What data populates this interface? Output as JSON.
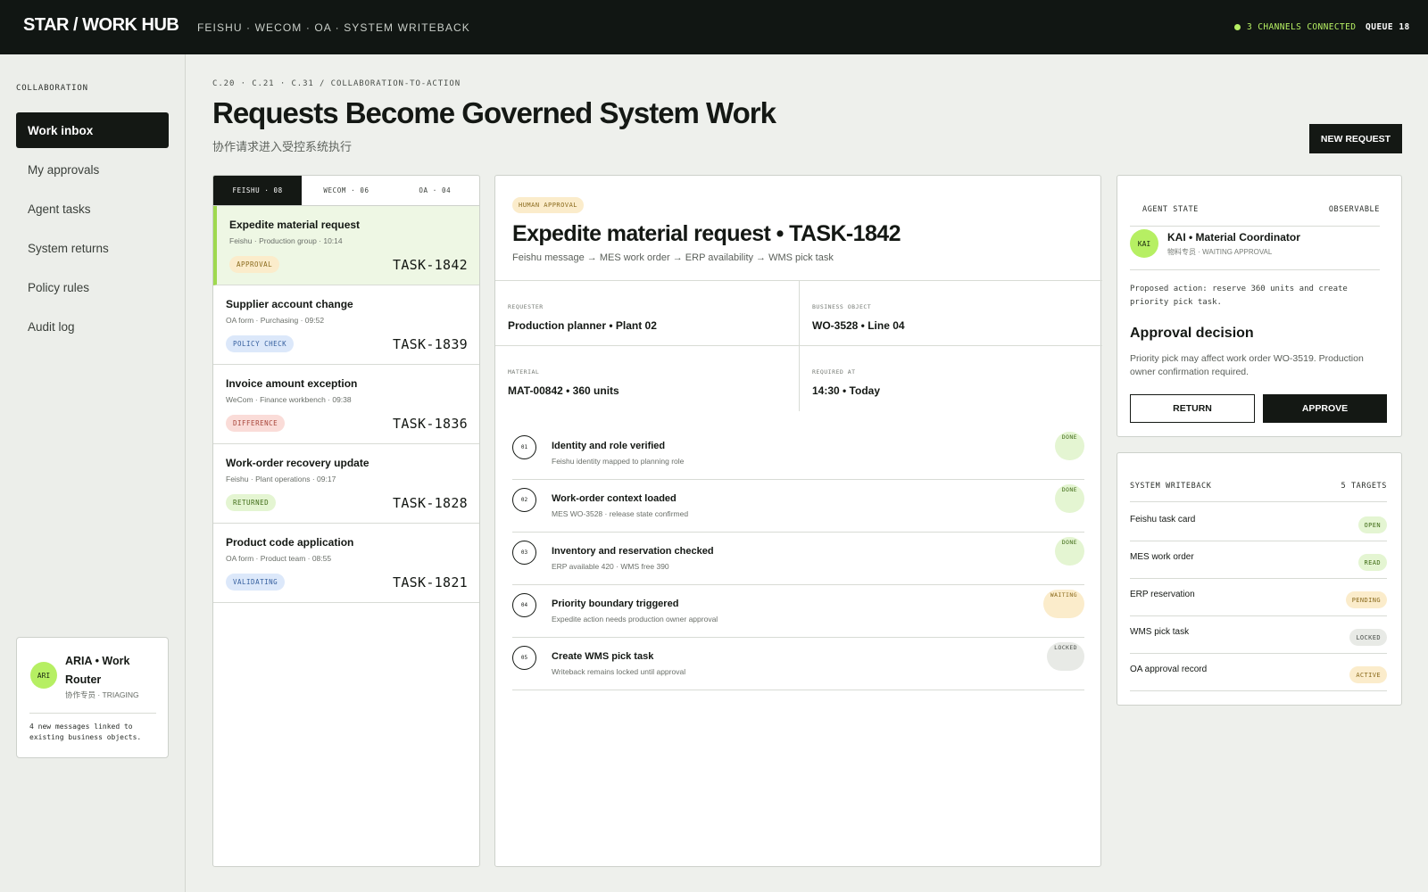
{
  "header": {
    "brand": "STAR / WORK HUB",
    "nav": "FEISHU · WECOM · OA · SYSTEM WRITEBACK",
    "channels": "3 CHANNELS CONNECTED",
    "queue": "QUEUE 18"
  },
  "sidebar": {
    "section_label": "COLLABORATION",
    "items": [
      {
        "label": "Work inbox"
      },
      {
        "label": "My approvals"
      },
      {
        "label": "Agent tasks"
      },
      {
        "label": "System returns"
      },
      {
        "label": "Policy rules"
      },
      {
        "label": "Audit log"
      }
    ],
    "agent": {
      "initials": "ARI",
      "name": "ARIA • Work Router",
      "sub": "协作专员 · TRIAGING",
      "message": "4 new messages linked to existing business objects."
    }
  },
  "page": {
    "breadcrumb": "C.20 · C.21 · C.31 / COLLABORATION-TO-ACTION",
    "title": "Requests Become Governed System Work",
    "subtitle": "协作请求进入受控系统执行",
    "new_request": "NEW REQUEST"
  },
  "list": {
    "tabs": [
      {
        "label": "FEISHU · 08"
      },
      {
        "label": "WECOM · 06"
      },
      {
        "label": "OA · 04"
      }
    ],
    "requests": [
      {
        "title": "Expedite material request",
        "meta": "Feishu · Production group · 10:14",
        "badge": "APPROVAL",
        "id": "TASK-1842"
      },
      {
        "title": "Supplier account change",
        "meta": "OA form · Purchasing · 09:52",
        "badge": "POLICY CHECK",
        "id": "TASK-1839"
      },
      {
        "title": "Invoice amount exception",
        "meta": "WeCom · Finance workbench · 09:38",
        "badge": "DIFFERENCE",
        "id": "TASK-1836"
      },
      {
        "title": "Work-order recovery update",
        "meta": "Feishu · Plant operations · 09:17",
        "badge": "RETURNED",
        "id": "TASK-1828"
      },
      {
        "title": "Product code application",
        "meta": "OA form · Product team · 08:55",
        "badge": "VALIDATING",
        "id": "TASK-1821"
      }
    ]
  },
  "detail": {
    "badge": "HUMAN APPROVAL",
    "title": "Expedite material request • TASK-1842",
    "flow": "Feishu message → MES work order → ERP availability → WMS pick task",
    "fields": [
      {
        "label": "REQUESTER",
        "value": "Production planner • Plant 02"
      },
      {
        "label": "BUSINESS OBJECT",
        "value": "WO-3528 • Line 04"
      },
      {
        "label": "MATERIAL",
        "value": "MAT-00842 • 360 units"
      },
      {
        "label": "REQUIRED AT",
        "value": "14:30 • Today"
      }
    ],
    "steps": [
      {
        "num": "01",
        "title": "Identity and role verified",
        "desc": "Feishu identity mapped to planning role",
        "status": "DONE"
      },
      {
        "num": "02",
        "title": "Work-order context loaded",
        "desc": "MES WO-3528 · release state confirmed",
        "status": "DONE"
      },
      {
        "num": "03",
        "title": "Inventory and reservation checked",
        "desc": "ERP available 420 · WMS free 390",
        "status": "DONE"
      },
      {
        "num": "04",
        "title": "Priority boundary triggered",
        "desc": "Expedite action needs production owner approval",
        "status": "WAITING"
      },
      {
        "num": "05",
        "title": "Create WMS pick task",
        "desc": "Writeback remains locked until approval",
        "status": "LOCKED"
      }
    ]
  },
  "agent_state": {
    "label": "AGENT STATE",
    "observable": "OBSERVABLE",
    "initials": "KAI",
    "name": "KAI • Material Coordinator",
    "sub": "物料专员 · WAITING APPROVAL",
    "proposed": "Proposed action: reserve 360 units and create priority pick task.",
    "decision_title": "Approval decision",
    "decision_text": "Priority pick may affect work order WO-3519. Production owner confirmation required.",
    "return_label": "RETURN",
    "approve_label": "APPROVE"
  },
  "writeback": {
    "label": "SYSTEM WRITEBACK",
    "targets": "5 TARGETS",
    "rows": [
      {
        "name": "Feishu task card",
        "status": "OPEN"
      },
      {
        "name": "MES work order",
        "status": "READ"
      },
      {
        "name": "ERP reservation",
        "status": "PENDING"
      },
      {
        "name": "WMS pick task",
        "status": "LOCKED"
      },
      {
        "name": "OA approval record",
        "status": "ACTIVE"
      }
    ]
  },
  "colors": {
    "accent": "#b6ef63",
    "dark": "#141814",
    "active_row": "#eef7e4"
  }
}
